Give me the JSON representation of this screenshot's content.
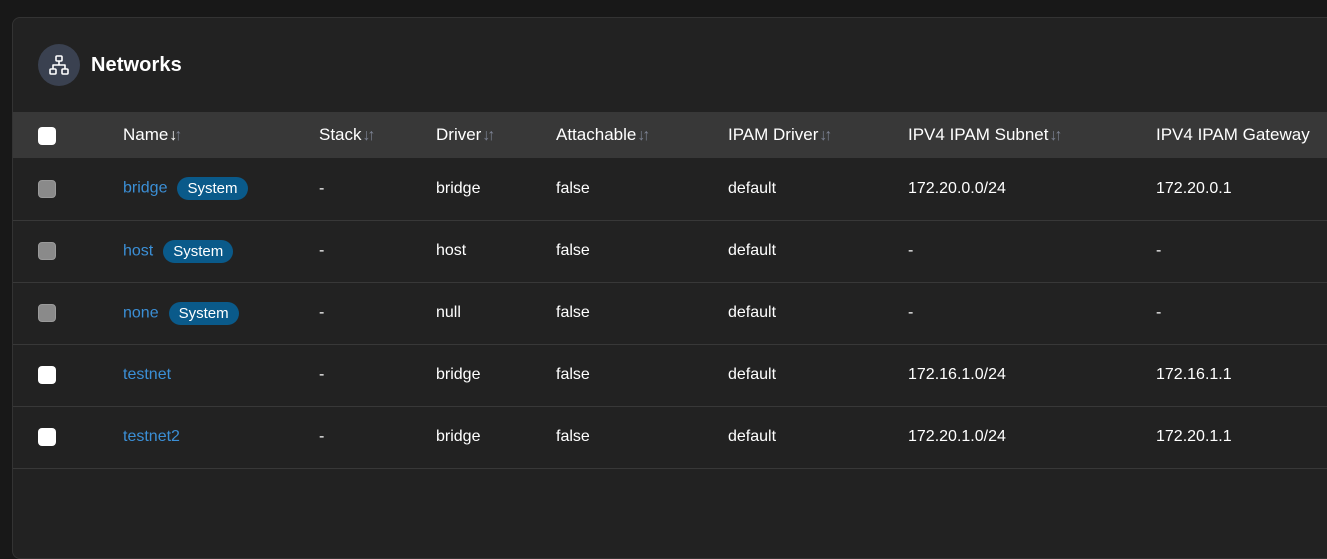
{
  "panel": {
    "title": "Networks",
    "icon": "network-icon"
  },
  "table": {
    "columns": [
      {
        "key": "name",
        "label": "Name",
        "sort": "desc"
      },
      {
        "key": "stack",
        "label": "Stack",
        "sort": "none"
      },
      {
        "key": "driver",
        "label": "Driver",
        "sort": "none"
      },
      {
        "key": "attachable",
        "label": "Attachable",
        "sort": "none"
      },
      {
        "key": "ipam_driver",
        "label": "IPAM Driver",
        "sort": "none"
      },
      {
        "key": "ipv4_subnet",
        "label": "IPV4 IPAM Subnet",
        "sort": "none"
      },
      {
        "key": "ipv4_gateway",
        "label": "IPV4 IPAM Gateway",
        "sort": "none"
      }
    ],
    "sort_arrows": {
      "down": "↓",
      "up": "↑"
    },
    "rows": [
      {
        "name": "bridge",
        "badge": "System",
        "system": true,
        "stack": "-",
        "driver": "bridge",
        "attachable": "false",
        "ipam_driver": "default",
        "ipv4_subnet": "172.20.0.0/24",
        "ipv4_gateway": "172.20.0.1"
      },
      {
        "name": "host",
        "badge": "System",
        "system": true,
        "stack": "-",
        "driver": "host",
        "attachable": "false",
        "ipam_driver": "default",
        "ipv4_subnet": "-",
        "ipv4_gateway": "-"
      },
      {
        "name": "none",
        "badge": "System",
        "system": true,
        "stack": "-",
        "driver": "null",
        "attachable": "false",
        "ipam_driver": "default",
        "ipv4_subnet": "-",
        "ipv4_gateway": "-"
      },
      {
        "name": "testnet",
        "badge": "",
        "system": false,
        "stack": "-",
        "driver": "bridge",
        "attachable": "false",
        "ipam_driver": "default",
        "ipv4_subnet": "172.16.1.0/24",
        "ipv4_gateway": "172.16.1.1"
      },
      {
        "name": "testnet2",
        "badge": "",
        "system": false,
        "stack": "-",
        "driver": "bridge",
        "attachable": "false",
        "ipam_driver": "default",
        "ipv4_subnet": "172.20.1.0/24",
        "ipv4_gateway": "172.20.1.1"
      }
    ]
  },
  "colors": {
    "link": "#3b8fd6",
    "badge_bg": "#0a5a8a",
    "header_bg": "#383838",
    "panel_bg": "#222222"
  }
}
